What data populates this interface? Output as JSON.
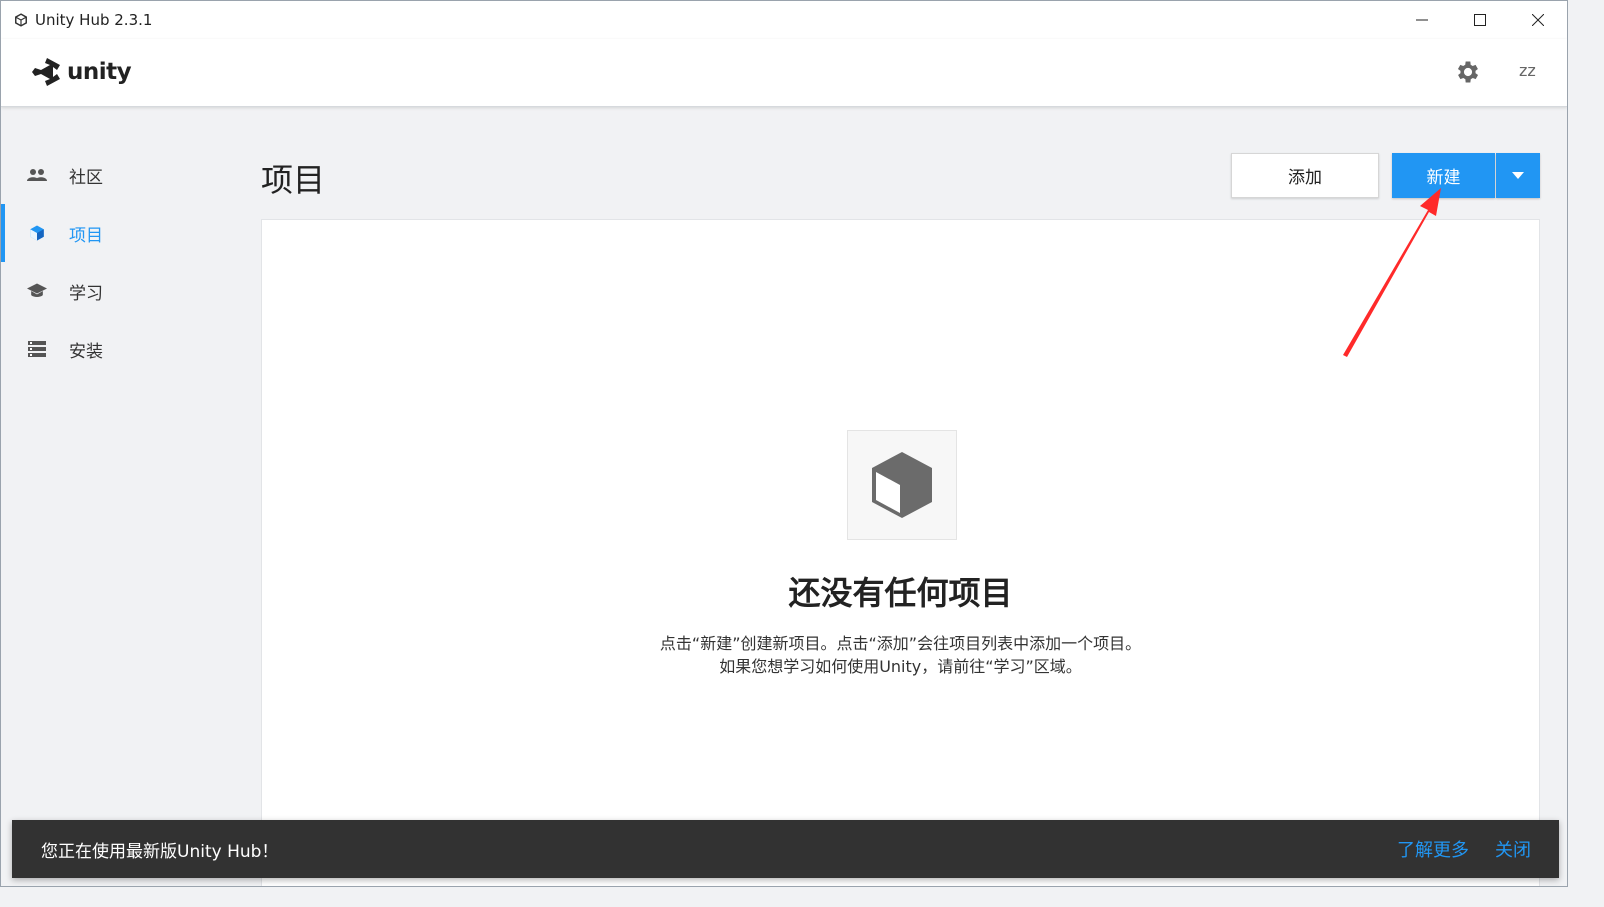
{
  "window": {
    "title": "Unity Hub 2.3.1"
  },
  "header": {
    "logo_text": "unity",
    "user_initials": "zz"
  },
  "sidebar": {
    "items": [
      {
        "label": "社区",
        "icon": "people-icon"
      },
      {
        "label": "项目",
        "icon": "cube-icon",
        "active": true
      },
      {
        "label": "学习",
        "icon": "graduation-cap-icon"
      },
      {
        "label": "安装",
        "icon": "list-icon"
      }
    ]
  },
  "main": {
    "title": "项目",
    "add_label": "添加",
    "new_label": "新建",
    "empty": {
      "title": "还没有任何项目",
      "line1": "点击“新建”创建新项目。点击“添加”会往项目列表中添加一个项目。",
      "line2": "如果您想学习如何使用Unity，请前往“学习”区域。"
    }
  },
  "toast": {
    "message": "您正在使用最新版Unity Hub！",
    "learn_more": "了解更多",
    "close": "关闭"
  },
  "colors": {
    "accent": "#2196f3",
    "annotation_arrow": "#ff2a2a",
    "toast_bg": "#323232"
  }
}
